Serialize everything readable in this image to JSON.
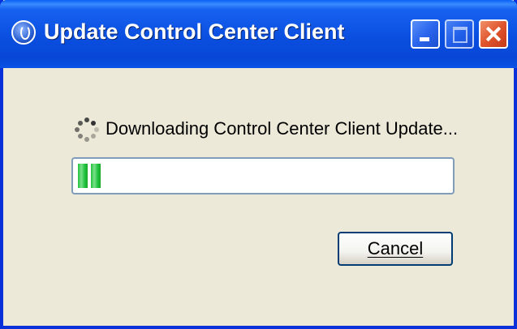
{
  "window": {
    "title": "Update Control Center Client",
    "app_icon": "update-app-icon",
    "controls": [
      "minimize-icon",
      "maximize-icon",
      "close-icon"
    ]
  },
  "status": {
    "spinner_icon": "loading-spinner-icon",
    "message": "Downloading Control Center Client Update..."
  },
  "progress": {
    "fraction": 0.07,
    "color": "#22c33d"
  },
  "buttons": {
    "cancel_label": "Cancel"
  },
  "colors": {
    "titlebar": "#0a4fe0",
    "background": "#ece9d8",
    "close_button": "#e0552d"
  }
}
